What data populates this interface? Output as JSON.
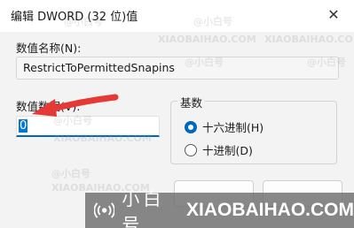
{
  "window": {
    "title": "编辑 DWORD (32 位)值",
    "close_glyph": "✕"
  },
  "value_name": {
    "label": "数值名称(N):",
    "value": "RestrictToPermittedSnapins"
  },
  "value_data": {
    "label": "数值数据(V):",
    "value": "0"
  },
  "base": {
    "title": "基数",
    "options": [
      {
        "label": "十六进制(H)",
        "selected": true
      },
      {
        "label": "十进制(D)",
        "selected": false
      }
    ]
  },
  "watermark": {
    "cn": "@小白号",
    "en": "XIAOBAIHAO.COM"
  },
  "banner": {
    "cn": "小白号",
    "en": "XIAOBAIHAO.COM"
  },
  "colors": {
    "accent": "#0067c0",
    "arrow": "#e53935"
  }
}
